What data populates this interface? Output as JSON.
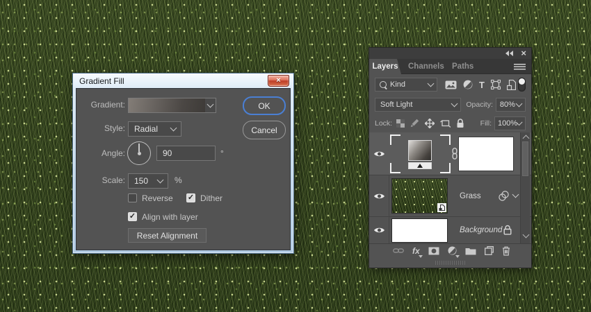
{
  "dialog": {
    "title": "Gradient Fill",
    "gradient_label": "Gradient:",
    "style_label": "Style:",
    "style_value": "Radial",
    "angle_label": "Angle:",
    "angle_value": "90",
    "angle_unit": "°",
    "scale_label": "Scale:",
    "scale_value": "150",
    "scale_unit": "%",
    "reverse_label": "Reverse",
    "dither_label": "Dither",
    "align_label": "Align with layer",
    "ok_label": "OK",
    "cancel_label": "Cancel",
    "reset_label": "Reset Alignment",
    "checkbox_states": {
      "reverse": false,
      "dither": true,
      "align_with_layer": true
    }
  },
  "layers_panel": {
    "tabs": [
      {
        "label": "Layers",
        "active": true
      },
      {
        "label": "Channels",
        "active": false
      },
      {
        "label": "Paths",
        "active": false
      }
    ],
    "filter_kind": "Kind",
    "filter_icons": [
      "pixel-layers",
      "adjustment-layers",
      "type-layers",
      "shape-layers",
      "smart-objects"
    ],
    "blend_mode": "Soft Light",
    "opacity_label": "Opacity:",
    "opacity_value": "80%",
    "lock_label": "Lock:",
    "fill_label": "Fill:",
    "fill_value": "100%",
    "layers": [
      {
        "name": "",
        "type": "gradient-fill-with-mask",
        "selected": true,
        "visible": true
      },
      {
        "name": "Grass",
        "type": "smart-object",
        "selected": false,
        "visible": true,
        "has_effects": true
      },
      {
        "name": "Background",
        "type": "background",
        "locked": true,
        "visible": true
      }
    ]
  },
  "icons": {
    "close": "×",
    "check": "✓",
    "type_tool": "T",
    "fx": "fx",
    "collapse": "◂◂"
  },
  "colors": {
    "accent_blue": "#4a7fd4",
    "panel_bg": "#535353",
    "titlebar_blue": "#c0d6ea",
    "close_red": "#bc3d27"
  }
}
